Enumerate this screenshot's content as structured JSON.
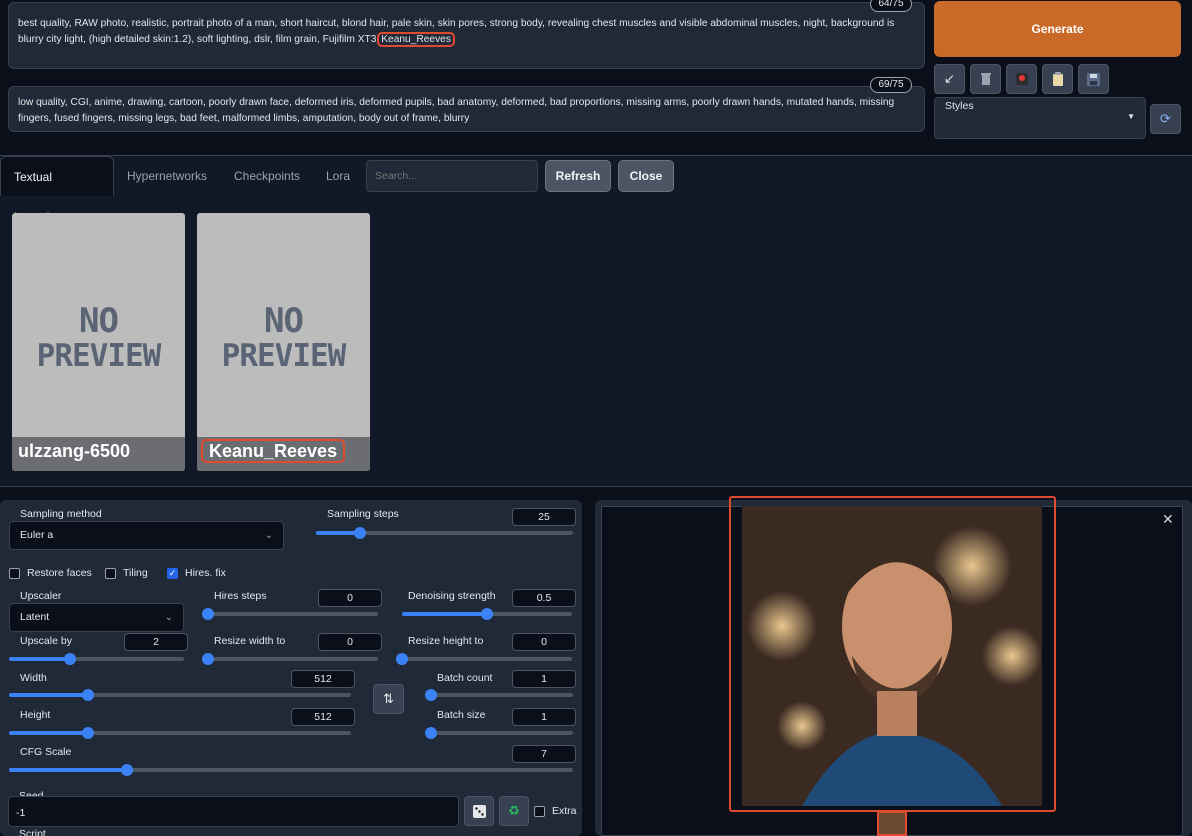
{
  "prompt": {
    "positive_text": "best quality, RAW photo, realistic, portrait photo of a man, short haircut, blond hair, pale skin, skin pores, strong body, revealing chest muscles and visible abdominal muscles, night, background is blurry city light, (high detailed skin:1.2), soft lighting, dslr, film grain, Fujifilm XT3",
    "positive_highlight": "Keanu_Reeves",
    "positive_counter": "64/75",
    "negative_text": "low quality, CGI, anime, drawing, cartoon, poorly drawn face, deformed iris, deformed pupils, bad anatomy, deformed, bad proportions, missing arms, poorly drawn hands, mutated hands, missing fingers, fused fingers, missing legs, bad feet, malformed limbs, amputation, body out of frame, blurry",
    "negative_counter": "69/75"
  },
  "actions": {
    "generate_label": "Generate",
    "styles_label": "Styles",
    "tool_icons": [
      "arrow-down-left-icon",
      "trash-icon",
      "red-dot-icon",
      "clipboard-icon",
      "save-icon"
    ]
  },
  "extra_networks": {
    "tabs": [
      "Textual Inversion",
      "Hypernetworks",
      "Checkpoints",
      "Lora"
    ],
    "search_placeholder": "Search...",
    "refresh_label": "Refresh",
    "close_label": "Close",
    "cards": [
      {
        "name": "ulzzang-6500",
        "preview_line1": "NO",
        "preview_line2": "PREVIEW"
      },
      {
        "name": "Keanu_Reeves",
        "preview_line1": "NO",
        "preview_line2": "PREVIEW"
      }
    ]
  },
  "settings": {
    "sampling_method_label": "Sampling method",
    "sampling_method_value": "Euler a",
    "sampling_steps_label": "Sampling steps",
    "sampling_steps_value": "25",
    "restore_faces_label": "Restore faces",
    "tiling_label": "Tiling",
    "hires_fix_label": "Hires. fix",
    "upscaler_label": "Upscaler",
    "upscaler_value": "Latent",
    "hires_steps_label": "Hires steps",
    "hires_steps_value": "0",
    "denoising_label": "Denoising strength",
    "denoising_value": "0.5",
    "upscale_by_label": "Upscale by",
    "upscale_by_value": "2",
    "resize_width_label": "Resize width to",
    "resize_width_value": "0",
    "resize_height_label": "Resize height to",
    "resize_height_value": "0",
    "width_label": "Width",
    "width_value": "512",
    "height_label": "Height",
    "height_value": "512",
    "batch_count_label": "Batch count",
    "batch_count_value": "1",
    "batch_size_label": "Batch size",
    "batch_size_value": "1",
    "cfg_label": "CFG Scale",
    "cfg_value": "7",
    "seed_label": "Seed",
    "seed_value": "-1",
    "extra_label": "Extra",
    "script_label": "Script"
  },
  "colors": {
    "accent": "#c96a28",
    "highlight": "#e04a2f",
    "slider": "#3b82f6"
  }
}
